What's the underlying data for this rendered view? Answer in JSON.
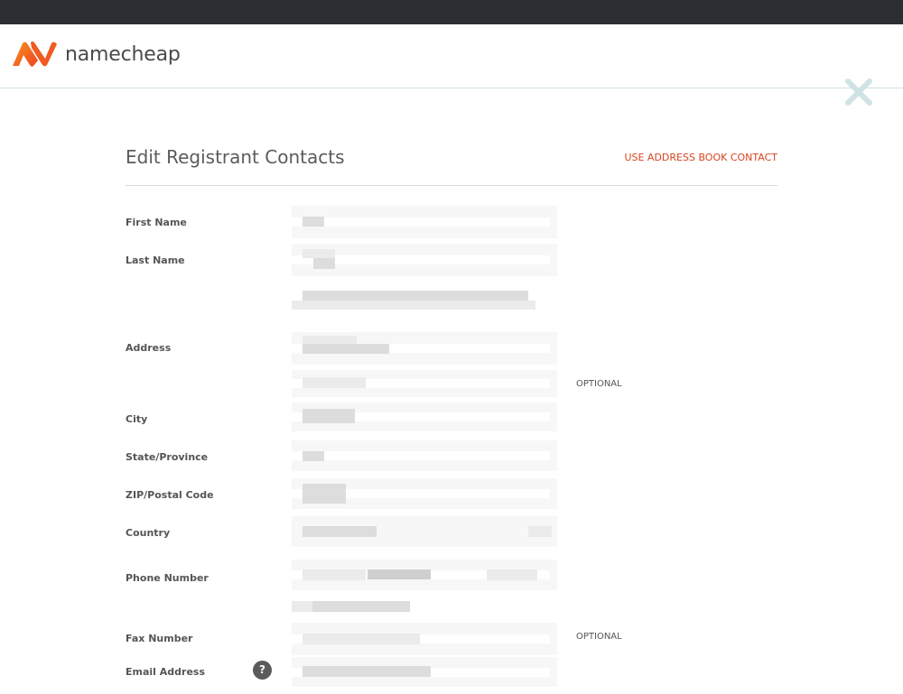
{
  "app": {
    "brand": "namecheap"
  },
  "header": {
    "close_icon": "close-icon"
  },
  "form": {
    "title": "Edit Registrant Contacts",
    "address_book_link": "USE ADDRESS BOOK CONTACT",
    "labels": {
      "first_name": "First Name",
      "last_name": "Last Name",
      "address": "Address",
      "city": "City",
      "state": "State/Province",
      "zip": "ZIP/Postal Code",
      "country": "Country",
      "phone": "Phone Number",
      "fax": "Fax Number",
      "email": "Email Address"
    },
    "optional_label": "OPTIONAL",
    "help_icon_glyph": "?"
  },
  "colors": {
    "accent": "#d9441f",
    "logo_orange": "#f15a22",
    "topbar": "#2b2e33",
    "close_icon": "#cfe3e4"
  }
}
